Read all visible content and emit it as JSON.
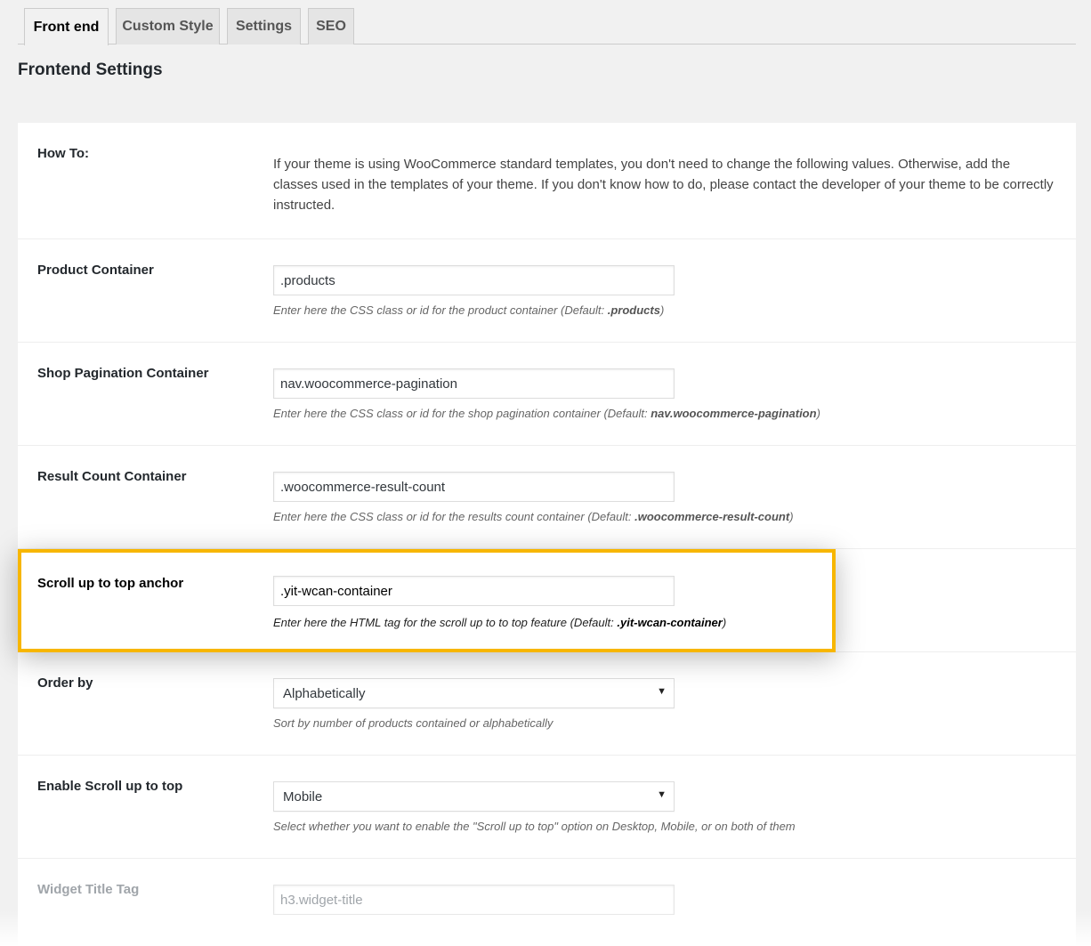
{
  "tabs": [
    {
      "label": "Front end",
      "active": true
    },
    {
      "label": "Custom Style",
      "active": false
    },
    {
      "label": "Settings",
      "active": false
    },
    {
      "label": "SEO",
      "active": false
    }
  ],
  "page_title": "Frontend Settings",
  "howto": {
    "label": "How To:",
    "text": "If your theme is using WooCommerce standard templates, you don't need to change the following values. Otherwise, add the classes used in the templates of your theme. If you don't know how to do, please contact the developer of your theme to be correctly instructed."
  },
  "fields": {
    "product_container": {
      "label": "Product Container",
      "value": ".products",
      "desc_prefix": "Enter here the CSS class or id for the product container (Default: ",
      "desc_default": ".products",
      "desc_suffix": ")"
    },
    "pagination_container": {
      "label": "Shop Pagination Container",
      "value": "nav.woocommerce-pagination",
      "desc_prefix": "Enter here the CSS class or id for the shop pagination container (Default: ",
      "desc_default": "nav.woocommerce-pagination",
      "desc_suffix": ")"
    },
    "result_count_container": {
      "label": "Result Count Container",
      "value": ".woocommerce-result-count",
      "desc_prefix": "Enter here the CSS class or id for the results count container (Default: ",
      "desc_default": ".woocommerce-result-count",
      "desc_suffix": ")"
    },
    "scroll_anchor": {
      "label": "Scroll up to top anchor",
      "value": ".yit-wcan-container",
      "desc_prefix": "Enter here the HTML tag for the scroll up to to top feature (Default: ",
      "desc_default": ".yit-wcan-container",
      "desc_suffix": ")",
      "highlight_color": "#f7b600"
    },
    "order_by": {
      "label": "Order by",
      "selected": "Alphabetically",
      "desc": "Sort by number of products contained or alphabetically"
    },
    "enable_scroll": {
      "label": "Enable Scroll up to top",
      "selected": "Mobile",
      "desc": "Select whether you want to enable the \"Scroll up to top\" option on Desktop, Mobile, or on both of them"
    },
    "widget_title_tag": {
      "label": "Widget Title Tag",
      "value": "h3.widget-title"
    }
  },
  "icons": {
    "select_arrow": "triangle-down"
  }
}
